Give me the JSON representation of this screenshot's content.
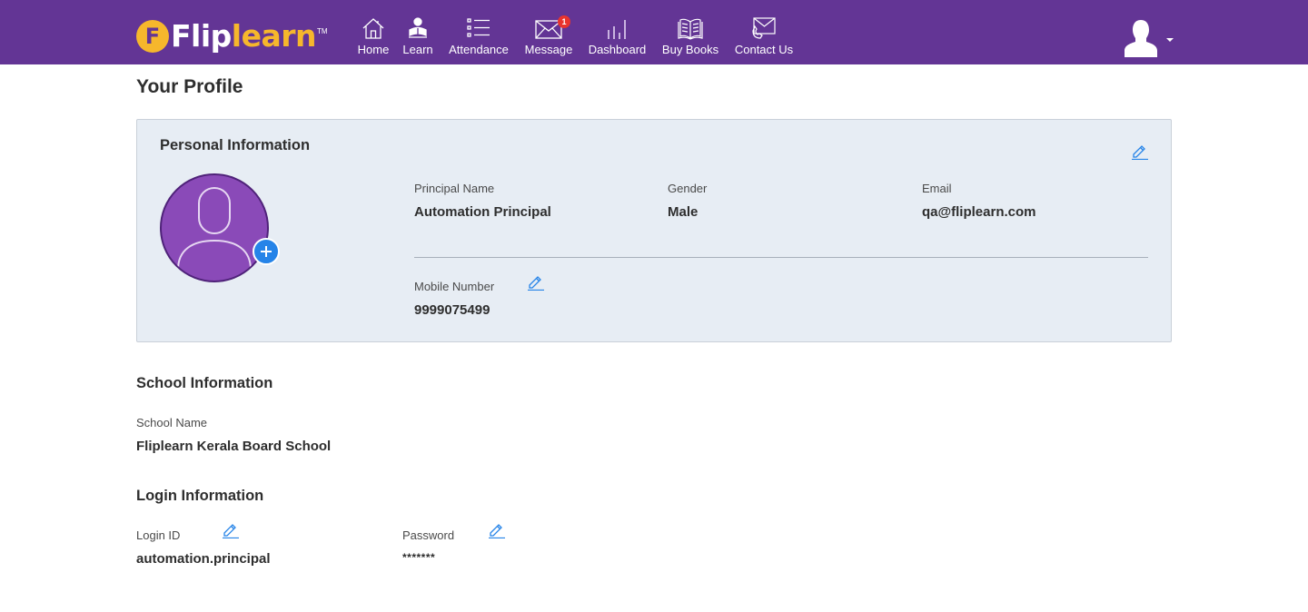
{
  "header": {
    "logo": {
      "text_part1": "Flip",
      "text_part2": "learn",
      "badge_letter": "F",
      "trademark": "TM"
    },
    "nav": [
      {
        "label": "Home",
        "icon": "home-icon"
      },
      {
        "label": "Learn",
        "icon": "learn-icon"
      },
      {
        "label": "Attendance",
        "icon": "list-icon"
      },
      {
        "label": "Message",
        "icon": "envelope-icon",
        "badge": "1"
      },
      {
        "label": "Dashboard",
        "icon": "bar-chart-icon"
      },
      {
        "label": "Buy Books",
        "icon": "book-icon"
      },
      {
        "label": "Contact Us",
        "icon": "contact-icon"
      }
    ],
    "user_menu_icon": "user-avatar-icon"
  },
  "page": {
    "title": "Your Profile"
  },
  "personal": {
    "title": "Personal Information",
    "principal_name_label": "Principal Name",
    "principal_name": "Automation Principal",
    "gender_label": "Gender",
    "gender": "Male",
    "email_label": "Email",
    "email": "qa@fliplearn.com",
    "mobile_label": "Mobile Number",
    "mobile": "9999075499"
  },
  "school": {
    "title": "School Information",
    "name_label": "School Name",
    "name": "Fliplearn Kerala Board School"
  },
  "login": {
    "title": "Login Information",
    "id_label": "Login ID",
    "id": "automation.principal",
    "password_label": "Password",
    "password": "*******"
  },
  "colors": {
    "brand_purple": "#633595",
    "brand_yellow": "#f6b72c",
    "card_bg": "#e7edf4",
    "accent_blue": "#2684e8",
    "badge_red": "#e8342d"
  }
}
